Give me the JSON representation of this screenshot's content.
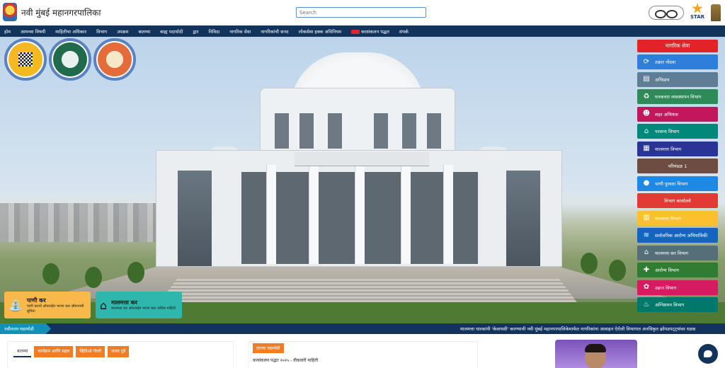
{
  "header": {
    "site_title": "नवी मुंबई महानगरपालिका",
    "search_placeholder": "Search",
    "star_label": "STAR"
  },
  "nav": {
    "items": [
      "होम",
      "आमच्या विषयी",
      "माहितीचा अधिकार",
      "विभाग",
      "उपक्रम",
      "बातम्या",
      "बाह्य पदाधोदी",
      "द्वार",
      "निविदा",
      "नागरिक सेवा",
      "नागरिकांची सनद",
      "लोकसेवा हक्क अधिनियम",
      "करसंकलन पद्धत",
      "संपर्क"
    ],
    "item_prefix_new": "करसंकलन पद्धत"
  },
  "hero": {
    "building_name": "नवी मुंबई महानगरपालिका"
  },
  "services": {
    "heading": "नागरिक सेवा",
    "items": [
      {
        "label": "तक्रार नोंदवा",
        "color": "#2f7ed8",
        "icon": "feedback-icon"
      },
      {
        "label": "अभिप्राय",
        "color": "#5f7d95",
        "icon": "comment-icon"
      },
      {
        "label": "घनकचरा व्यवस्थापन विभाग",
        "color": "#2e8b57",
        "icon": "recycle-icon"
      },
      {
        "label": "शहर अभियंता",
        "color": "#c2185b",
        "icon": "engineer-icon"
      },
      {
        "label": "परवाना विभाग",
        "color": "#00897b",
        "icon": "home-icon"
      },
      {
        "label": "मालमत्ता विभाग",
        "color": "#283593",
        "icon": "clipboard-icon"
      },
      {
        "label": "परिमंडळ 1",
        "color": "#6d4c41",
        "icon": ""
      },
      {
        "label": "पाणी पुरवठा विभाग",
        "color": "#1e88e5",
        "icon": "water-drop-icon"
      },
      {
        "label": "विभाग कार्यालये",
        "color": "#e53935",
        "icon": ""
      },
      {
        "label": "मालमत्ता विभाग",
        "color": "#fbc02d",
        "icon": "bar-chart-icon"
      },
      {
        "label": "सार्वजनिक आरोग्य अभियांत्रिकी",
        "color": "#1565c0",
        "icon": "waves-icon"
      },
      {
        "label": "मालमत्ता कर विभाग",
        "color": "#546e7a",
        "icon": "home-icon"
      },
      {
        "label": "आरोग्य विभाग",
        "color": "#2e7d32",
        "icon": "medical-kit-icon"
      },
      {
        "label": "उद्यान विभाग",
        "color": "#d81b60",
        "icon": "flower-icon"
      },
      {
        "label": "अग्निशमन विभाग",
        "color": "#00796b",
        "icon": "fire-icon"
      }
    ]
  },
  "tax_cards": {
    "water": {
      "title": "पाणी कर",
      "desc": "पाणी कराचे ऑनलाईन भरणा करा श्रीमानाची सुविधा"
    },
    "property": {
      "title": "मालमत्ता कर",
      "desc": "मालमत्ता कर ऑनलाईन भरणा करा अधिक माहिती"
    }
  },
  "ticker": {
    "label": "नवीनतम घडामोडी",
    "text": "मालमत्ता धारकांनी 'केवायसी' करण्याची नवी मुंबई महानगरपालिकेमार्फत नागरिकांना आवाहन   ऐरोली विभागात अनधिकृत झोपडपट्ट्यांवर धडक"
  },
  "bottom": {
    "tabs": [
      "बातम्या",
      "कार्यक्रम आणि सहल",
      "व्हिडिओ गॅलरी",
      "जलद दुवे"
    ],
    "highlight_label": "ताज्या घडामोडी",
    "highlight_sub": "करसंकलन पद्धत २०२५ - वीकवारी माहिती"
  }
}
